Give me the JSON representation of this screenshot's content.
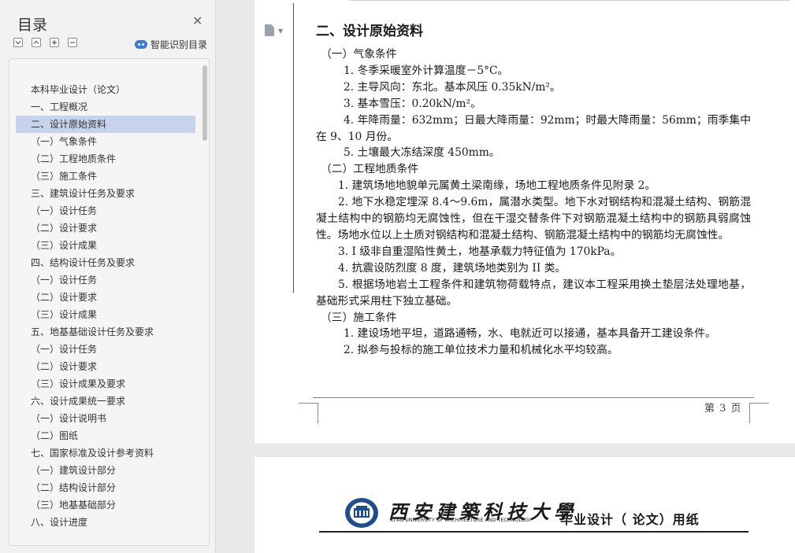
{
  "toc": {
    "title": "目录",
    "smart_label": "智能识别目录",
    "items": [
      {
        "label": "本科毕业设计（论文）"
      },
      {
        "label": "一、工程概况"
      },
      {
        "label": "二、设计原始资料"
      },
      {
        "label": "（一）气象条件"
      },
      {
        "label": "（二）工程地质条件"
      },
      {
        "label": "（三）施工条件"
      },
      {
        "label": "三、建筑设计任务及要求"
      },
      {
        "label": "（一）设计任务"
      },
      {
        "label": "（二）设计要求"
      },
      {
        "label": "（三）设计成果"
      },
      {
        "label": "四、结构设计任务及要求"
      },
      {
        "label": "（一）设计任务"
      },
      {
        "label": "（二）设计要求"
      },
      {
        "label": "（三）设计成果"
      },
      {
        "label": "五、地基基础设计任务及要求"
      },
      {
        "label": "（一）设计任务"
      },
      {
        "label": "（二）设计要求"
      },
      {
        "label": "（三）设计成果及要求"
      },
      {
        "label": "六、设计成果统一要求"
      },
      {
        "label": "（一）设计说明书"
      },
      {
        "label": "（二）图纸"
      },
      {
        "label": "七、国家标准及设计参考资料"
      },
      {
        "label": "（一）建筑设计部分"
      },
      {
        "label": "（二）结构设计部分"
      },
      {
        "label": "（三）地基基础部分"
      },
      {
        "label": "八、设计进度"
      }
    ]
  },
  "doc": {
    "heading": "二、设计原始资料",
    "paragraphs": [
      {
        "text": "（一）气象条件",
        "style": "sec"
      },
      {
        "text": "1. 冬季采暖室外计算温度－5°C。",
        "style": "i1"
      },
      {
        "text": "2. 主导风向：东北。基本风压 0.35kN/m²。",
        "style": "i1"
      },
      {
        "text": "3. 基本雪压：0.20kN/m²。",
        "style": "i1"
      },
      {
        "text": "4. 年降雨量：632mm；日最大降雨量：92mm；时最大降雨量：56mm；雨季集中在 9、10 月份。",
        "style": "i1"
      },
      {
        "text": "5. 土壤最大冻结深度 450mm。",
        "style": "i1"
      },
      {
        "text": "（二）工程地质条件",
        "style": "sec"
      },
      {
        "text": "1. 建筑场地地貌单元属黄土梁南缘，场地工程地质条件见附录 2。",
        "style": "i2"
      },
      {
        "text": "2. 地下水稳定埋深 8.4～9.6m，属潜水类型。地下水对钢结构和混凝土结构、钢筋混凝土结构中的钢筋均无腐蚀性，但在干湿交替条件下对钢筋混凝土结构中的钢筋具弱腐蚀性。场地水位以上土质对钢结构和混凝土结构、钢筋混凝土结构中的钢筋均无腐蚀性。",
        "style": "i2"
      },
      {
        "text": "3. I 级非自重湿陷性黄土，地基承载力特征值为 170kPa。",
        "style": "i2"
      },
      {
        "text": "4. 抗震设防烈度 8 度，建筑场地类别为 II 类。",
        "style": "i2"
      },
      {
        "text": "5. 根据场地岩土工程条件和建筑物荷载特点，建议本工程采用换土垫层法处理地基，基础形式采用柱下独立基础。",
        "style": "i2"
      },
      {
        "text": "（三）施工条件",
        "style": "sec"
      },
      {
        "text": "1. 建设场地平坦，道路通畅，水、电就近可以接通，基本具备开工建设条件。",
        "style": "i1"
      },
      {
        "text": "2. 拟参与投标的施工单位技术力量和机械化水平均较高。",
        "style": "i1"
      }
    ],
    "footer": "第 3 页"
  },
  "header2": {
    "univ_cn": "西安建築科技大學",
    "univ_en": "XI'AN UNIVERSITY OF ARCHITECTURE AND TECHNOLOGY",
    "paper_label": "毕业设计（ 论文）用纸"
  },
  "colors": {
    "selected_bg": "#c6d3ec",
    "accent": "#3a7bd5",
    "logo": "#1f4d8f"
  },
  "icons": [
    "close-icon",
    "collapse-all-icon",
    "expand-all-icon",
    "add-icon",
    "remove-icon",
    "smart-toc-icon",
    "page-nav-icon",
    "university-logo"
  ]
}
